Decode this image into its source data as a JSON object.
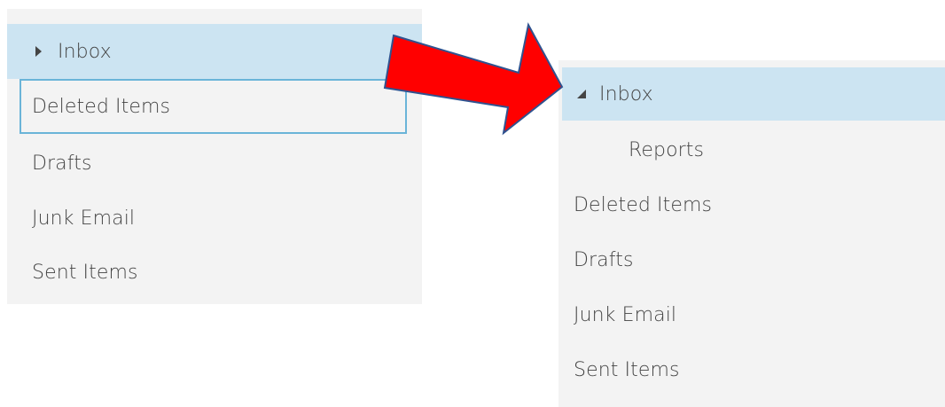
{
  "left_pane": {
    "items": [
      {
        "label": "Inbox"
      },
      {
        "label": "Deleted Items"
      },
      {
        "label": "Drafts"
      },
      {
        "label": "Junk Email"
      },
      {
        "label": "Sent Items"
      }
    ]
  },
  "right_pane": {
    "items": [
      {
        "label": "Inbox"
      },
      {
        "label": "Reports"
      },
      {
        "label": "Deleted Items"
      },
      {
        "label": "Drafts"
      },
      {
        "label": "Junk Email"
      },
      {
        "label": "Sent Items"
      }
    ]
  },
  "colors": {
    "pane_background": "#f3f3f3",
    "selected_background": "#cce4f2",
    "focus_border": "#6ab4d8",
    "arrow_fill": "#ff0000",
    "arrow_stroke": "#2f528f"
  },
  "icons": {
    "collapsed_caret": "caret-right-icon",
    "expanded_caret": "caret-down-icon",
    "transition_arrow": "red-arrow-icon"
  }
}
